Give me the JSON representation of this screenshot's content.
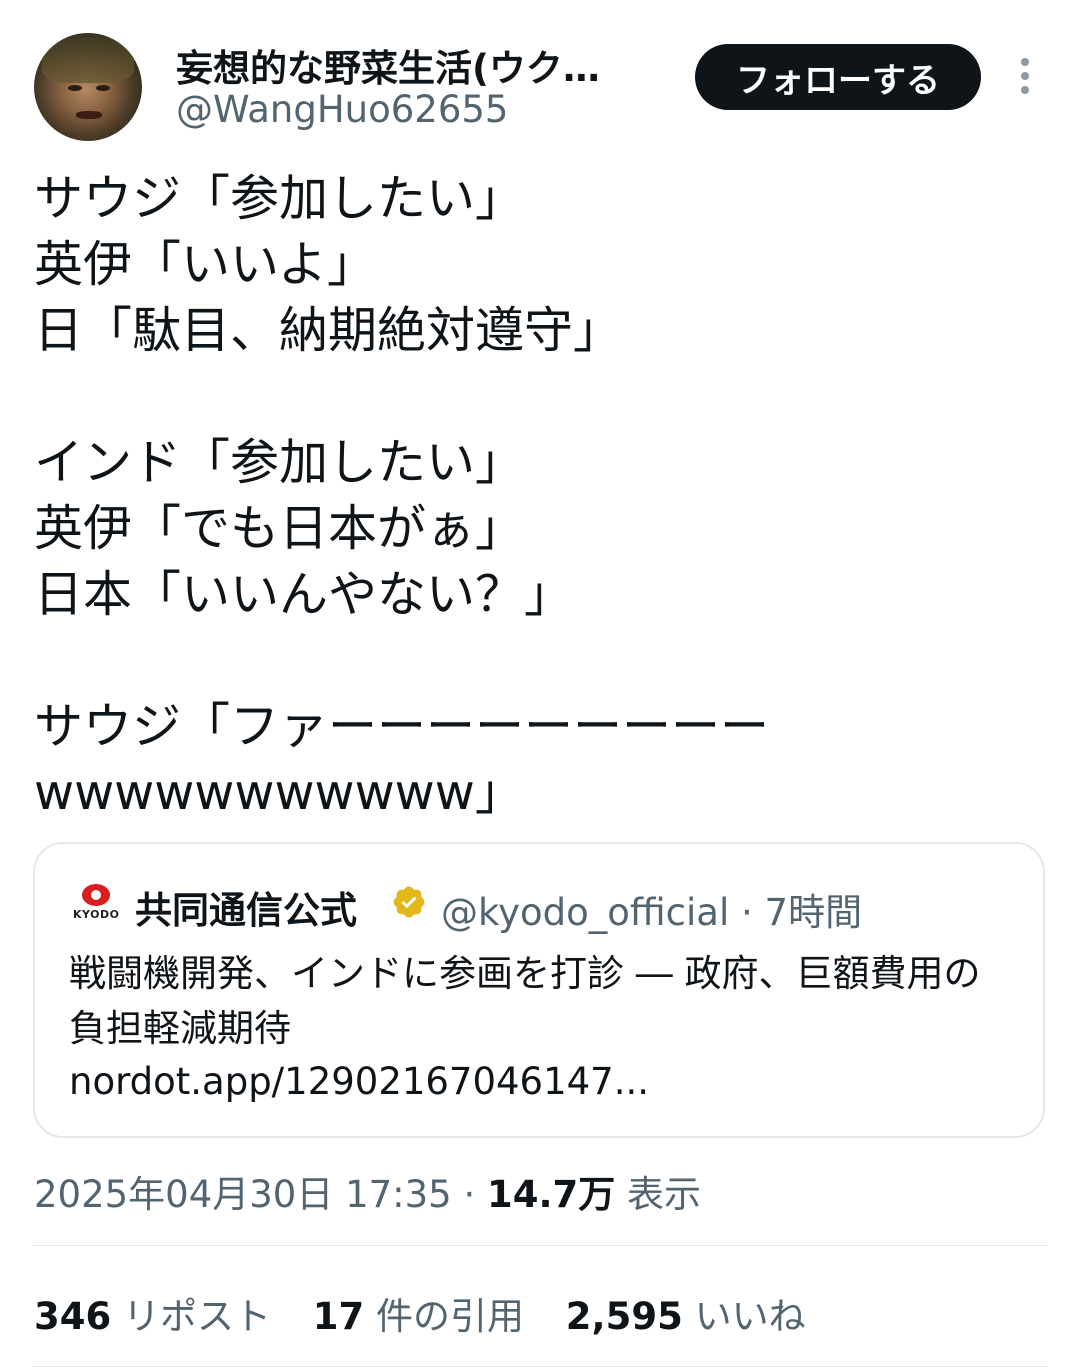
{
  "author": {
    "display_name": "妄想的な野菜生活(ウク…",
    "handle": "@WangHuo62655"
  },
  "follow_button": "フォローする",
  "tweet_lines": [
    "サウジ「参加したい」",
    "英伊「いいよ」",
    "日「駄目、納期絶対遵守」",
    "",
    "インド「参加したい」",
    "英伊「でも日本がぁ」",
    "日本「いいんやない？」",
    "",
    "サウジ「ファーーーーーーーーー",
    "wwwwwwwwwww」"
  ],
  "quote": {
    "logo_text": "KYODO",
    "name": "共同通信公式",
    "handle_time": "@kyodo_official · 7時間",
    "text": "戦闘機開発、インドに参画を打診 ― 政府、巨額費用の負担軽減期待",
    "link": "nordot.app/12902167046147..."
  },
  "meta": {
    "timestamp": "2025年04月30日 17:35 · ",
    "views": "14.7万",
    "views_label": " 表示"
  },
  "stats": {
    "reposts": "346",
    "reposts_label": " リポスト",
    "quotes": "17",
    "quotes_label": " 件の引用",
    "likes": "2,595",
    "likes_label": " いいね"
  },
  "colors": {
    "text": "#0f1419",
    "secondary": "#536471",
    "button_bg": "#0f1419",
    "verified_gold": "#e2b719",
    "border": "#e3e8ec"
  }
}
